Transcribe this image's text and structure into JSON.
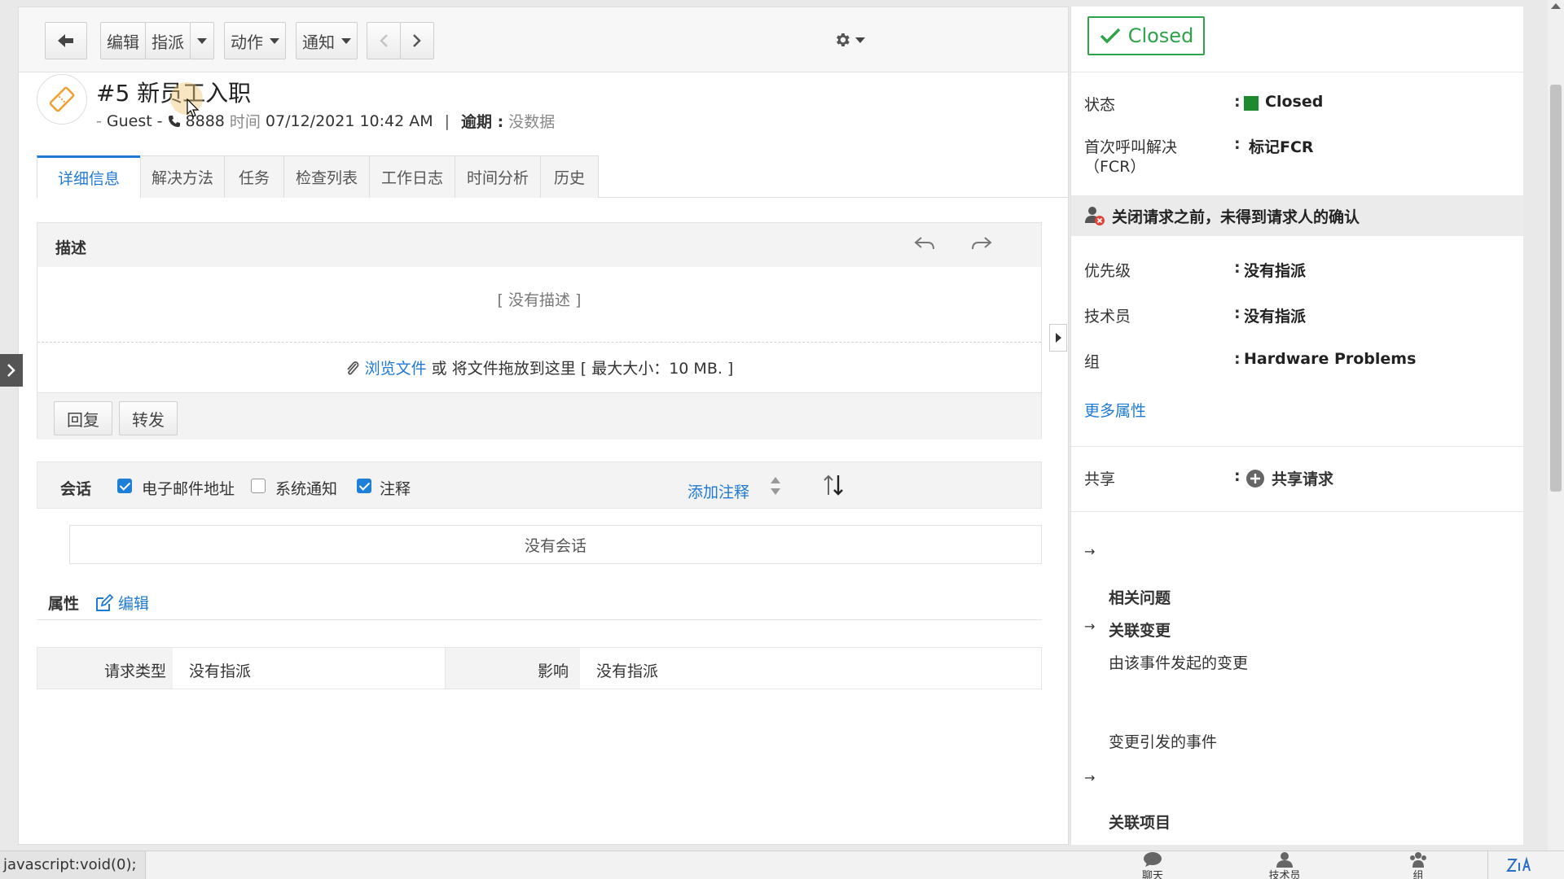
{
  "toolbar": {
    "edit": "编辑",
    "assign": "指派",
    "actions": "动作",
    "notify": "通知"
  },
  "ticket": {
    "title": "#5  新员工入职",
    "requester": "Guest",
    "phone": "8888",
    "time_label": "时间",
    "time_value": "07/12/2021 10:42 AM",
    "due_label": "逾期 :",
    "due_value": "没数据"
  },
  "tabs": [
    "详细信息",
    "解决方法",
    "任务",
    "检查列表",
    "工作日志",
    "时间分析",
    "历史"
  ],
  "description": {
    "title": "描述",
    "empty": "[ 没有描述 ]",
    "browse": "浏览文件",
    "drop_text": "或 将文件拖放到这里 [ 最大大小：10 MB. ]",
    "reply": "回复",
    "forward": "转发"
  },
  "conversation": {
    "title": "会话",
    "email_label": "电子邮件地址",
    "email_checked": true,
    "system_label": "系统通知",
    "system_checked": false,
    "note_label": "注释",
    "note_checked": true,
    "add_note": "添加注释",
    "empty": "没有会话"
  },
  "properties": {
    "title": "属性",
    "edit": "编辑",
    "request_type_label": "请求类型",
    "request_type_value": "没有指派",
    "impact_label": "影响",
    "impact_value": "没有指派"
  },
  "sidebar": {
    "closed_button": "Closed",
    "status_label": "状态",
    "status_value": "Closed",
    "status_color": "#1e8a2e",
    "fcr_label_1": "首次呼叫解决",
    "fcr_label_2": "（FCR）",
    "fcr_value": "标记FCR",
    "warning": "关闭请求之前，未得到请求人的确认",
    "priority_label": "优先级",
    "priority_value": "没有指派",
    "technician_label": "技术员",
    "technician_value": "没有指派",
    "group_label": "组",
    "group_value": "Hardware Problems",
    "more": "更多属性",
    "share_label": "共享",
    "share_value": "共享请求",
    "related_problems": "相关问题",
    "linked_changes": "关联变更",
    "changes_from_incident": "由该事件发起的变更",
    "incidents_from_change": "变更引发的事件",
    "linked_projects": "关联项目"
  },
  "statusbar": {
    "url": "javascript:void(0);",
    "chat": "聊天",
    "technician": "技术员",
    "group": "组"
  },
  "colors": {
    "accent": "#1f7ad6",
    "closed_green": "#2ea34a"
  }
}
